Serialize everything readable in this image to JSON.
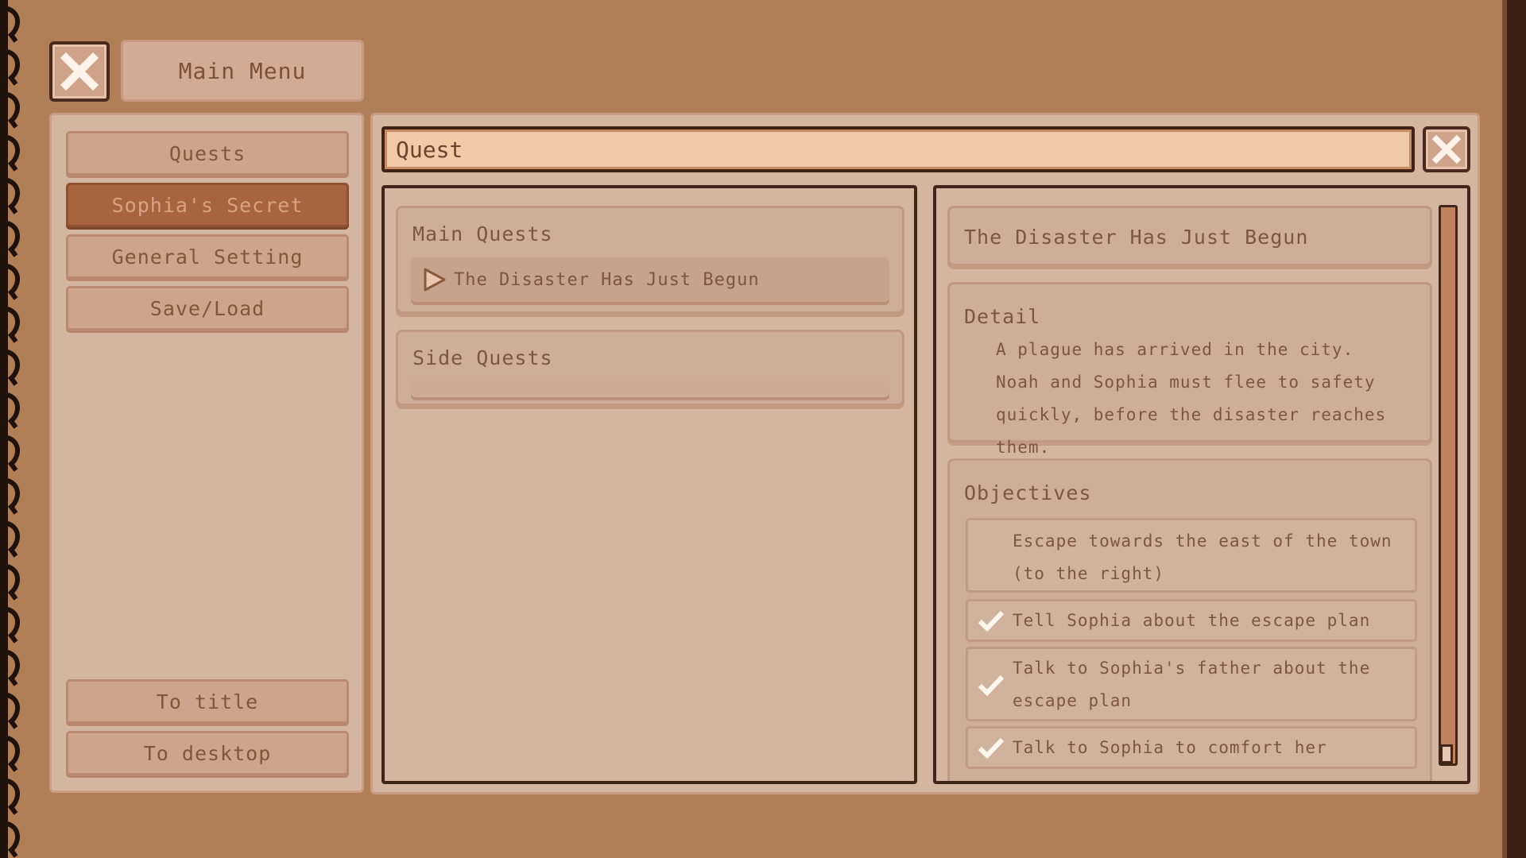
{
  "header": {
    "menu_title": "Main Menu"
  },
  "sidebar": {
    "items": [
      {
        "label": "Quests",
        "active": false
      },
      {
        "label": "Sophia's Secret",
        "active": true
      },
      {
        "label": "General Setting",
        "active": false
      },
      {
        "label": "Save/Load",
        "active": false
      }
    ],
    "bottom": [
      {
        "label": "To title"
      },
      {
        "label": "To desktop"
      }
    ]
  },
  "search": {
    "value": "Quest"
  },
  "quest_list": {
    "main_title": "Main Quests",
    "main_items": [
      "The Disaster Has Just Begun"
    ],
    "side_title": "Side Quests"
  },
  "quest_detail": {
    "title": "The Disaster Has Just Begun",
    "detail_heading": "Detail",
    "detail_text": "A plague has arrived in the city. Noah and Sophia must flee to safety quickly, before the disaster reaches them.",
    "objectives_heading": "Objectives",
    "objectives": [
      {
        "text": "Escape towards the east of the town (to the right)",
        "done": false
      },
      {
        "text": "Tell Sophia about the escape plan",
        "done": true
      },
      {
        "text": "Talk to Sophia's father about the escape plan",
        "done": true
      },
      {
        "text": "Talk to Sophia to comfort her",
        "done": true
      }
    ]
  },
  "colors": {
    "background": "#b07f58",
    "panel": "#d4b6a0",
    "active_item": "#a7643f",
    "search_field": "#f1caa6",
    "outline": "#40251a",
    "text": "#7b5238"
  },
  "icons": [
    "close-icon",
    "play-arrow-icon",
    "checkmark-icon",
    "binder-coil-icon"
  ]
}
